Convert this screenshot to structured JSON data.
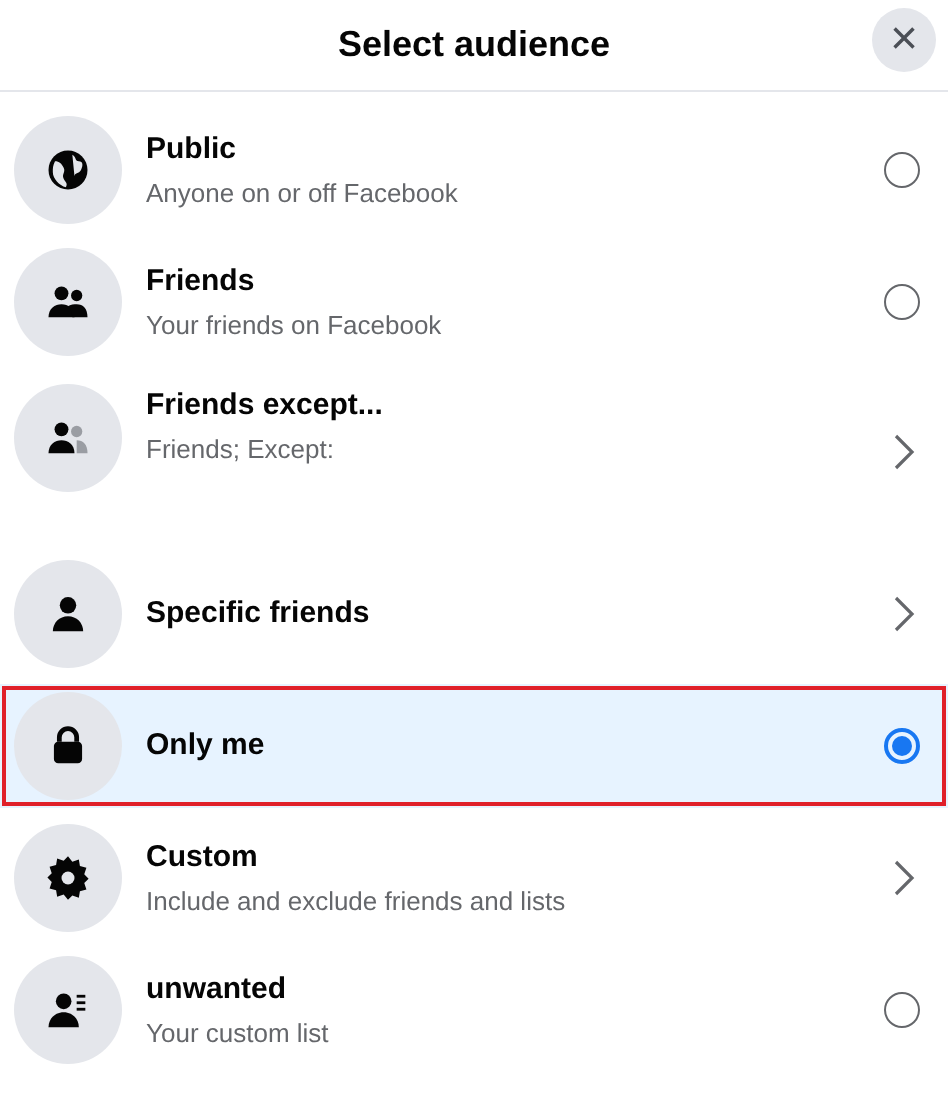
{
  "header": {
    "title": "Select audience",
    "close": "×"
  },
  "options": [
    {
      "title": "Public",
      "subtitle": "Anyone on or off Facebook",
      "kind": "radio",
      "selected": false
    },
    {
      "title": "Friends",
      "subtitle": "Your friends on Facebook",
      "kind": "radio",
      "selected": false
    },
    {
      "title": "Friends except...",
      "subtitle": "Friends; Except:",
      "kind": "chevron",
      "selected": false
    },
    {
      "title": "Specific friends",
      "kind": "chevron",
      "selected": false
    },
    {
      "title": "Only me",
      "kind": "radio",
      "selected": true
    },
    {
      "title": "Custom",
      "subtitle": "Include and exclude friends and lists",
      "kind": "chevron",
      "selected": false
    },
    {
      "title": "unwanted",
      "subtitle": "Your custom list",
      "kind": "radio",
      "selected": false
    }
  ]
}
